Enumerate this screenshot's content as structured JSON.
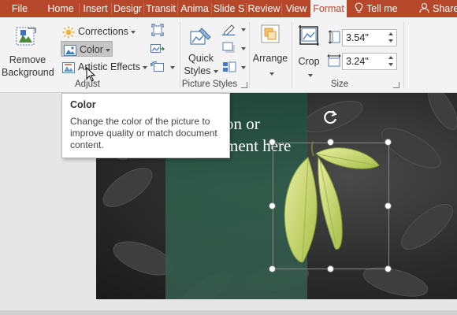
{
  "tabs": [
    {
      "label": "File",
      "active": false
    },
    {
      "label": "Home",
      "active": false
    },
    {
      "label": "Insert",
      "active": false
    },
    {
      "label": "Design",
      "active": false
    },
    {
      "label": "Transitions",
      "active": false
    },
    {
      "label": "Animations",
      "active": false
    },
    {
      "label": "Slide Show",
      "active": false
    },
    {
      "label": "Review",
      "active": false
    },
    {
      "label": "View",
      "active": false
    },
    {
      "label": "Format",
      "active": true
    }
  ],
  "tabs_display": [
    "File",
    "Home",
    "Insert",
    "Desigr",
    "Transit",
    "Anima",
    "Slide S",
    "Review",
    "View",
    "Format"
  ],
  "tell_me": "Tell me",
  "share": "Share",
  "ribbon": {
    "remove_background_line1": "Remove",
    "remove_background_line2": "Background",
    "corrections": "Corrections",
    "color": "Color",
    "artistic_effects": "Artistic Effects",
    "adjust_label": "Adjust",
    "quick_styles_line1": "Quick",
    "quick_styles_line2": "Styles",
    "picture_styles_label": "Picture Styles",
    "arrange": "Arrange",
    "crop": "Crop",
    "height_value": "3.54\"",
    "width_value": "3.24\"",
    "size_label": "Size"
  },
  "tooltip": {
    "title": "Color",
    "body": "Change the color of the picture to improve quality or match document content."
  },
  "slide": {
    "text_line1": "on or",
    "text_line2": "ment here"
  },
  "colors": {
    "accent": "#b7472a",
    "ribbon_bg": "#f3f3f3",
    "leaf": "#d2dd7e"
  }
}
